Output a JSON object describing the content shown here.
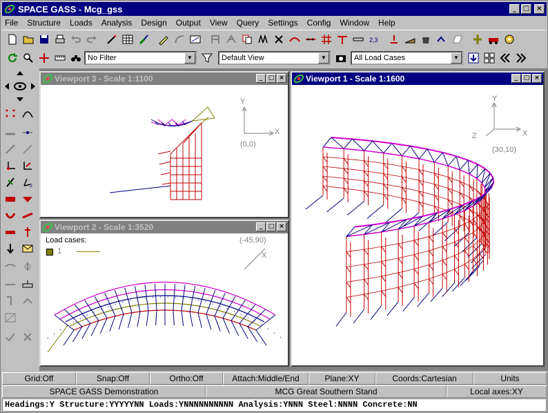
{
  "app": {
    "title_app": "SPACE GASS",
    "title_sep": " - ",
    "title_doc": "Mcg_gss"
  },
  "window_buttons": {
    "minimize": "_",
    "maximize": "□",
    "close": "×"
  },
  "menu": [
    "File",
    "Structure",
    "Loads",
    "Analysis",
    "Design",
    "Output",
    "View",
    "Query",
    "Settings",
    "Config",
    "Window",
    "Help"
  ],
  "toolbar2": {
    "filter_value": "No Filter",
    "view_value": "Default View",
    "loadcase_value": "All Load Cases"
  },
  "viewports": {
    "vp3": {
      "title": "Viewport 3 - Scale 1:1100",
      "axis_y": "Y",
      "axis_x": "X",
      "coords": "(0,0)"
    },
    "vp1": {
      "title": "Viewport 1 - Scale 1:1600",
      "axis_y": "Y",
      "axis_x": "X",
      "axis_z": "Z",
      "coords": "(30,10)"
    },
    "vp2": {
      "title": "Viewport 2 - Scale 1:3520",
      "axis_x": "X",
      "coords": "(-45,90)",
      "load_cases_label": "Load cases:",
      "load_case_1": "1"
    }
  },
  "status_row1": [
    "Grid:Off",
    "Snap:Off",
    "Ortho:Off",
    "Attach:Middle/End",
    "Plane:XY",
    "Coords:Cartesian",
    "Units"
  ],
  "status_row2": [
    "SPACE GASS Demonstration",
    "MCG Great Southern Stand",
    "Local axes:XY"
  ],
  "status_row3": "Headings:Y Structure:YYYYYNN Loads:YNNNNNNNNNN Analysis:YNNN Steel:NNNN Concrete:NN",
  "colors": {
    "title_active": "#000080",
    "title_inactive": "#808080",
    "structure_red": "#c00000",
    "structure_magenta": "#d000d0",
    "structure_navy": "#000080",
    "load_swatch": "#808000"
  },
  "icons": {
    "app": "spacegass-logo-icon"
  }
}
